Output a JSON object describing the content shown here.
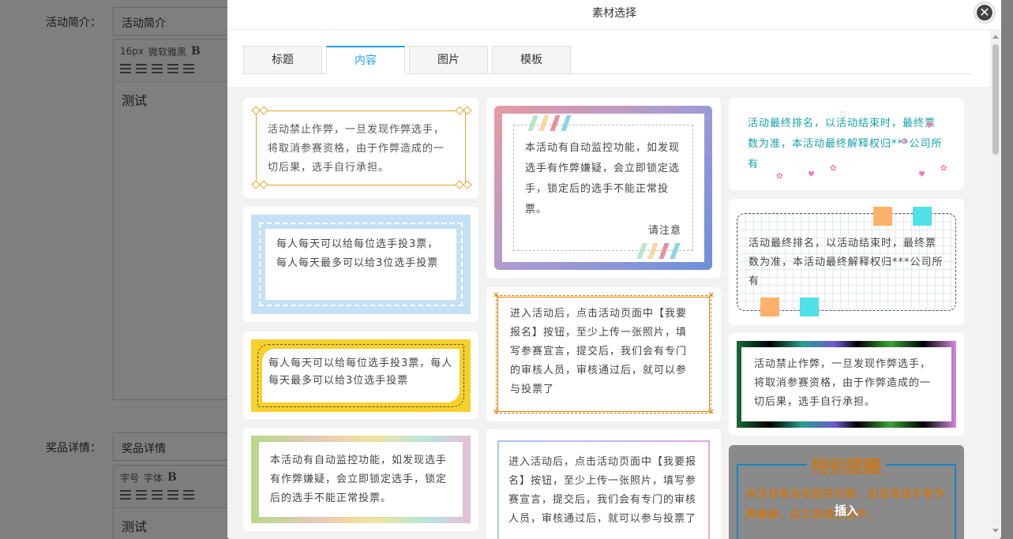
{
  "background": {
    "activity_intro_label": "活动简介：",
    "activity_intro_value": "活动简介",
    "editor1": {
      "font_size": "16px",
      "font_family": "微软雅黑",
      "bold": "B",
      "content": "测试"
    },
    "prize_label": "奖品详情：",
    "prize_value": "奖品详情",
    "editor2": {
      "font_size": "字号",
      "font_family": "字体",
      "bold": "B",
      "content": "测试"
    }
  },
  "modal": {
    "title": "素材选择",
    "close_icon": "close-icon",
    "tabs": [
      {
        "label": "标题",
        "active": false
      },
      {
        "label": "内容",
        "active": true
      },
      {
        "label": "图片",
        "active": false
      },
      {
        "label": "模板",
        "active": false
      }
    ],
    "cards": {
      "c1": "活动禁止作弊，一旦发现作弊选手，将取消参赛资格，由于作弊造成的一切后果，选手自行承担。",
      "c2": "每人每天可以给每位选手投3票，每人每天最多可以给3位选手投票",
      "c3": "每人每天可以给每位选手投3票，每人每天最多可以给3位选手投票",
      "c4": "本活动有自动监控功能，如发现选手有作弊嫌疑，会立即锁定选手，锁定后的选手不能正常投票。",
      "c5_text": "本活动有自动监控功能，如发现选手有作弊嫌疑，会立即锁定选手，锁定后的选手不能正常投票。",
      "c5_sign": "请注意",
      "c6": "进入活动后，点击活动页面中【我要报名】按钮，至少上传一张照片，填写参赛宣言，提交后，我们会有专门的审核人员，审核通过后，就可以参与投票了",
      "c7": "进入活动后，点击活动页面中【我要报名】按钮，至少上传一张照片，填写参赛宣言，提交后，我们会有专门的审核人员，审核通过后，就可以参与投票了",
      "c8": "活动最终排名，以活动结束时，最终票数为准，本活动最终解释权归***公司所有",
      "c9": "活动最终排名，以活动结束时，最终票数为准，本活动最终解释权归***公司所有",
      "c10": "活动禁止作弊，一旦发现作弊选手，将取消参赛资格，由于作弊造成的一切后果，选手自行承担。",
      "c11_title": "特别提醒",
      "c11_text": "本活动有自动监控功能，如发现选手有作弊嫌疑，会立即锁定选手，",
      "c11_insert": "插入"
    }
  },
  "colors": {
    "accent": "#1e9fff",
    "gold": "#e5a526",
    "teal": "#13a3a6",
    "orange": "#e07b00"
  }
}
